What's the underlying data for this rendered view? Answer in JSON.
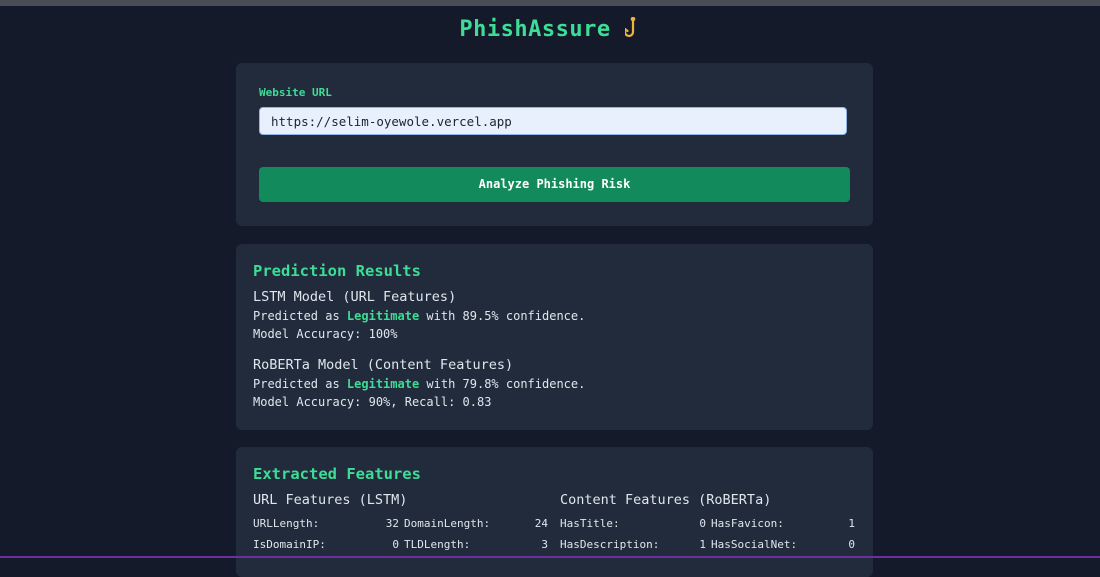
{
  "app": {
    "title": "PhishAssure",
    "hook_glyph": "𝒥"
  },
  "form": {
    "url_label": "Website URL",
    "url_value": "https://selim-oyewole.vercel.app",
    "analyze_label": "Analyze Phishing Risk"
  },
  "results": {
    "title": "Prediction Results",
    "lstm": {
      "title": "LSTM Model (URL Features)",
      "pred_prefix": "Predicted as ",
      "pred_label": "Legitimate",
      "pred_suffix": " with 89.5% confidence.",
      "accuracy": "Model Accuracy: 100%"
    },
    "roberta": {
      "title": "RoBERTa Model (Content Features)",
      "pred_prefix": "Predicted as ",
      "pred_label": "Legitimate",
      "pred_suffix": " with 79.8% confidence.",
      "accuracy": "Model Accuracy: 90%, Recall: 0.83"
    }
  },
  "features": {
    "title": "Extracted Features",
    "url_title": "URL Features (LSTM)",
    "content_title": "Content Features (RoBERTa)",
    "url_rows": [
      [
        {
          "name": "URLLength:",
          "value": "32"
        },
        {
          "name": "DomainLength:",
          "value": "24"
        }
      ],
      [
        {
          "name": "IsDomainIP:",
          "value": "0"
        },
        {
          "name": "TLDLength:",
          "value": "3"
        }
      ]
    ],
    "content_rows": [
      [
        {
          "name": "HasTitle:",
          "value": "0"
        },
        {
          "name": "HasFavicon:",
          "value": "1"
        }
      ],
      [
        {
          "name": "HasDescription:",
          "value": "1"
        },
        {
          "name": "HasSocialNet:",
          "value": "0"
        }
      ]
    ]
  }
}
